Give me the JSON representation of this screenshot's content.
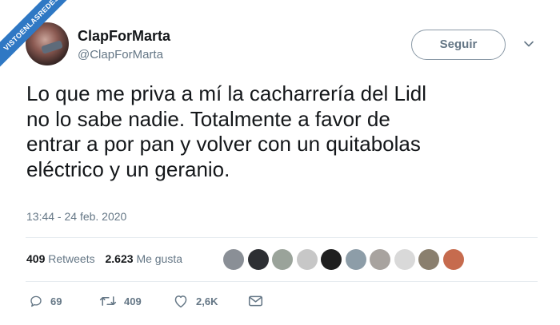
{
  "watermark": {
    "text": "VISTOENLASREDES"
  },
  "author": {
    "display_name": "ClapForMarta",
    "handle": "@ClapForMarta"
  },
  "follow_button": {
    "label": "Seguir"
  },
  "tweet": {
    "text": "Lo que me priva a mí la cacharrería del Lidl\nno lo sabe nadie. Totalmente a favor de\nentrar a por pan y volver con un quitabolas\neléctrico y un geranio.",
    "timestamp": "13:44 - 24 feb. 2020"
  },
  "stats": {
    "retweets_count": "409",
    "retweets_label": "Retweets",
    "likes_count": "2.623",
    "likes_label": "Me gusta"
  },
  "likers": [
    {
      "name": "liker-avatar-1",
      "color": "#8a8f96"
    },
    {
      "name": "liker-avatar-2",
      "color": "#2d2f33"
    },
    {
      "name": "liker-avatar-3",
      "color": "#9aa39a"
    },
    {
      "name": "liker-avatar-4",
      "color": "#c7c7c7"
    },
    {
      "name": "liker-avatar-5",
      "color": "#1f1f1f"
    },
    {
      "name": "liker-avatar-6",
      "color": "#8d9da8"
    },
    {
      "name": "liker-avatar-7",
      "color": "#a8a39f"
    },
    {
      "name": "liker-avatar-8",
      "color": "#d9d9d9"
    },
    {
      "name": "liker-avatar-9",
      "color": "#8a7f6e"
    },
    {
      "name": "liker-avatar-10",
      "color": "#c66b4e"
    }
  ],
  "actions": {
    "reply_icon": "reply-icon",
    "reply_count": "69",
    "retweet_icon": "retweet-icon",
    "retweet_count": "409",
    "like_icon": "heart-icon",
    "like_count": "2,6K",
    "dm_icon": "envelope-icon"
  },
  "colors": {
    "text": "#14171a",
    "secondary": "#657786",
    "divider": "#e6ecf0",
    "watermark": "#2f78c4"
  }
}
